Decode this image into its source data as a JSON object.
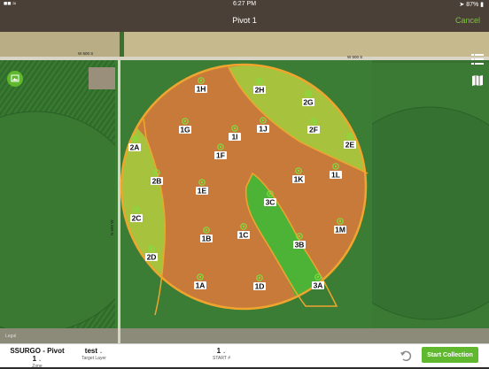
{
  "status": {
    "time": "6:27 PM",
    "battery": "87%"
  },
  "nav": {
    "title": "Pivot 1",
    "cancel_label": "Cancel"
  },
  "map": {
    "roads": [
      "W 600 S",
      "W 500 S",
      "N 650 W"
    ],
    "legal_label": "Legal",
    "points": [
      {
        "id": "1H"
      },
      {
        "id": "2H"
      },
      {
        "id": "2G"
      },
      {
        "id": "1G"
      },
      {
        "id": "1I"
      },
      {
        "id": "1J"
      },
      {
        "id": "2F"
      },
      {
        "id": "2A"
      },
      {
        "id": "1F"
      },
      {
        "id": "2E"
      },
      {
        "id": "2B"
      },
      {
        "id": "1E"
      },
      {
        "id": "1K"
      },
      {
        "id": "1L"
      },
      {
        "id": "3C"
      },
      {
        "id": "2C"
      },
      {
        "id": "1B"
      },
      {
        "id": "1C"
      },
      {
        "id": "1M"
      },
      {
        "id": "3B"
      },
      {
        "id": "2D"
      },
      {
        "id": "1A"
      },
      {
        "id": "1D"
      },
      {
        "id": "3A"
      }
    ],
    "colors": {
      "zone1": "#c87a3a",
      "zone2": "#a7c23c",
      "zone3": "#4db336",
      "outline": "#f0a52e"
    }
  },
  "bottom": {
    "zone_value": "SSURGO - Pivot 1",
    "zone_label": "Zone",
    "target_value": "test",
    "target_label": "Target Layer",
    "start_value": "1",
    "start_label": "START #",
    "start_button": "Start Collection"
  }
}
